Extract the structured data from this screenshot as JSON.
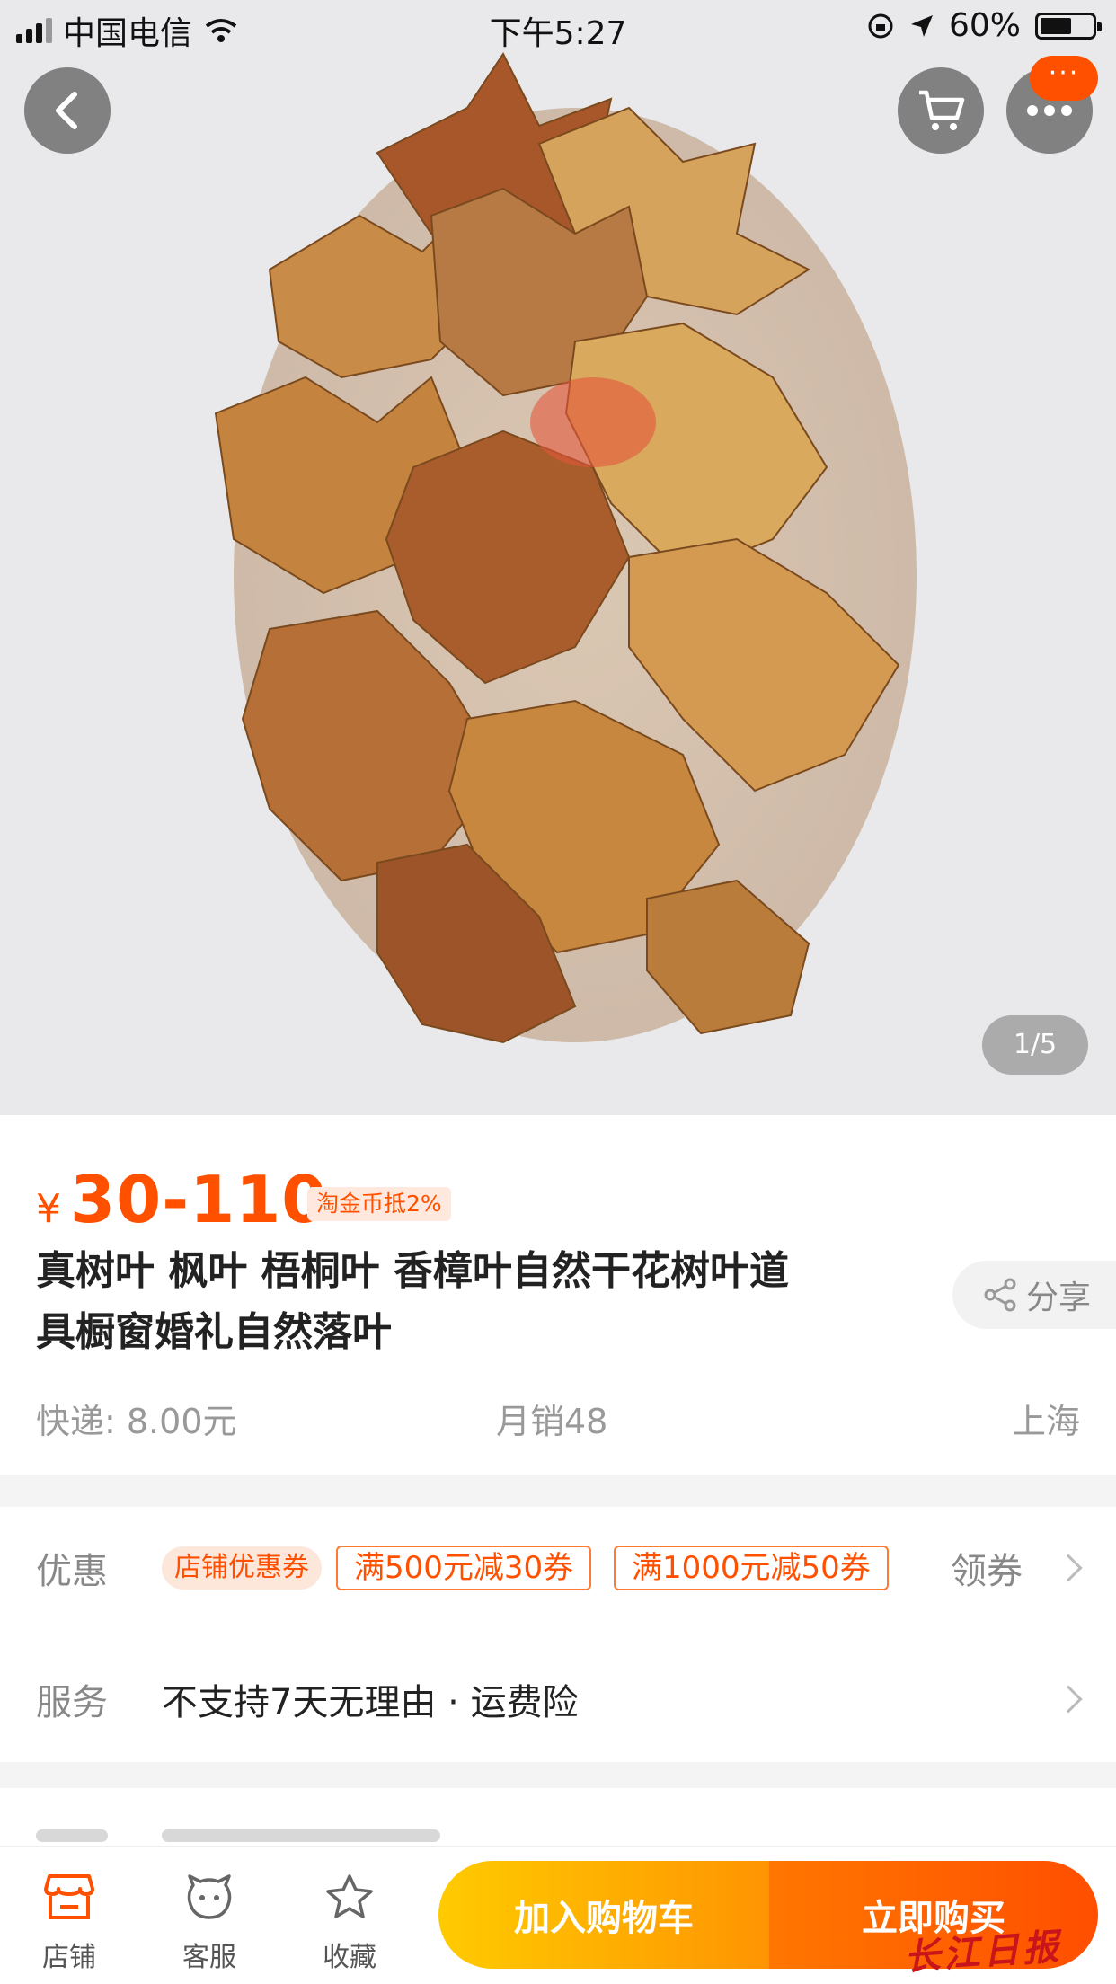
{
  "status_bar": {
    "carrier": "中国电信",
    "time": "下午5:27",
    "battery_percent": "60%",
    "battery_level": 0.6
  },
  "gallery": {
    "pager": "1/5",
    "notification_badge": "···"
  },
  "product": {
    "currency": "¥",
    "price": "30-110",
    "coin_tag": "淘金币抵2%",
    "title_line1": "真树叶 枫叶 梧桐叶 香樟叶自然干花树叶道",
    "title_line2": "具橱窗婚礼自然落叶",
    "share_label": "分享",
    "shipping": "快递: 8.00元",
    "monthly_sales": "月销48",
    "location": "上海"
  },
  "promotions": {
    "label": "优惠",
    "shop_coupon": "店铺优惠券",
    "coupons": [
      "满500元减30券",
      "满1000元减50券"
    ],
    "claim": "领券"
  },
  "services": {
    "label": "服务",
    "text": "不支持7天无理由 · 运费险"
  },
  "bottom_bar": {
    "tabs": [
      {
        "label": "店铺",
        "icon": "shop-icon"
      },
      {
        "label": "客服",
        "icon": "customer-service-icon"
      },
      {
        "label": "收藏",
        "icon": "star-icon"
      }
    ],
    "add_to_cart": "加入购物车",
    "buy_now": "立即购买"
  },
  "watermark": "长江日报",
  "colors": {
    "accent": "#ff5000",
    "cart_gradient_start": "#ffcb00",
    "buy_gradient_end": "#ff4e00"
  }
}
